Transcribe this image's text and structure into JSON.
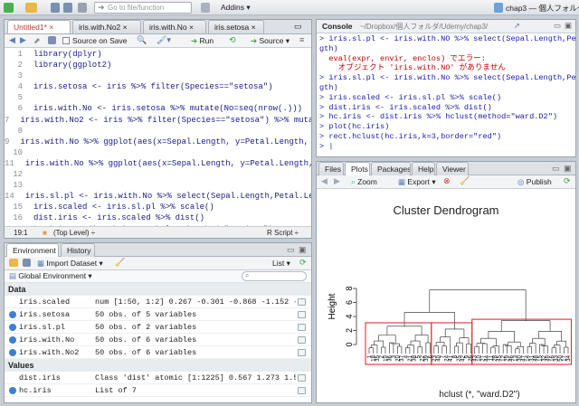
{
  "toolbar": {
    "goto_placeholder": "Go to file/function",
    "addins": "Addins",
    "project": "chap3 — 個人フォルダ"
  },
  "editor": {
    "tabs": [
      "Untitled1*",
      "iris.with.No2",
      "iris.with.No",
      "iris.setosa"
    ],
    "source_on_save": "Source on Save",
    "run": "Run",
    "source": "Source",
    "lines": [
      "library(dplyr)",
      "library(ggplot2)",
      "",
      "iris.setosa <- iris %>% filter(Species==\"setosa\")",
      "",
      "iris.with.No <- iris.setosa %>% mutate(No=seq(nrow(.)))",
      "iris.with.No2 <- iris %>% filter(Species==\"setosa\") %>% mutate(No=seq(nr",
      "",
      "iris.with.No %>% ggplot(aes(x=Sepal.Length, y=Petal.Length, color=Species",
      "",
      "iris.with.No %>% ggplot(aes(x=Sepal.Length, y=Petal.Length, color=Species",
      "",
      "",
      "iris.sl.pl <- iris.with.No %>% select(Sepal.Length,Petal.Length)",
      "iris.scaled <- iris.sl.pl %>% scale()",
      "dist.iris <- iris.scaled %>% dist()",
      "hc.iris <- dist.iris %>% hclust(method=\"ward.D2\")",
      "plot(hc.iris)",
      "rect.hclust(hc.iris,k=3,border=\"red\")",
      ""
    ],
    "status_pos": "19:1",
    "status_level": "(Top Level) ÷",
    "status_type": "R Script ÷"
  },
  "console": {
    "title": "Console",
    "path": "~/Dropbox/個人フォルダ/Udemy/chap3/",
    "lines": [
      {
        "t": "> iris.sl.pl <- iris.with.NO %>% select(Sepal.Length,Petal.Length)",
        "c": "#1a1ab0"
      },
      {
        "t": "gth)",
        "c": "#1a1ab0"
      },
      {
        "t": "  eval(expr, envir, enclos) でエラー:",
        "c": "#c00000"
      },
      {
        "t": "    オブジェクト 'iris.with.NO' がありません",
        "c": "#c00000"
      },
      {
        "t": "> iris.sl.pl <- iris.with.No %>% select(Sepal.Length,Petal.Length)",
        "c": "#1a1ab0"
      },
      {
        "t": "gth)",
        "c": "#1a1ab0"
      },
      {
        "t": "> iris.scaled <- iris.sl.pl %>% scale()",
        "c": "#1a1ab0"
      },
      {
        "t": "> dist.iris <- iris.scaled %>% dist()",
        "c": "#1a1ab0"
      },
      {
        "t": "> hc.iris <- dist.iris %>% hclust(method=\"ward.D2\")",
        "c": "#1a1ab0"
      },
      {
        "t": "> plot(hc.iris)",
        "c": "#1a1ab0"
      },
      {
        "t": "> rect.hclust(hc.iris,k=3,border=\"red\")",
        "c": "#1a1ab0"
      },
      {
        "t": "> |",
        "c": "#1a1ab0"
      }
    ]
  },
  "env": {
    "tabs": [
      "Environment",
      "History"
    ],
    "import": "Import Dataset",
    "list": "List",
    "global": "Global Environment",
    "data_header": "Data",
    "values_header": "Values",
    "data": [
      {
        "name": "iris.scaled",
        "desc": "num [1:50, 1:2] 0.267 -0.301 -0.868 -1.152 -0.0",
        "expand": false
      },
      {
        "name": "iris.setosa",
        "desc": "50 obs. of 5 variables",
        "expand": true
      },
      {
        "name": "iris.sl.pl",
        "desc": "50 obs. of 2 variables",
        "expand": true
      },
      {
        "name": "iris.with.No",
        "desc": "50 obs. of 6 variables",
        "expand": true
      },
      {
        "name": "iris.with.No2",
        "desc": "50 obs. of 6 variables",
        "expand": true
      }
    ],
    "values": [
      {
        "name": "dist.iris",
        "desc": "Class 'dist'  atomic [1:1225] 0.567 1.273 1.531 0.",
        "expand": false
      },
      {
        "name": "hc.iris",
        "desc": "List of 7",
        "expand": true
      }
    ]
  },
  "plots": {
    "tabs": [
      "Files",
      "Plots",
      "Packages",
      "Help",
      "Viewer"
    ],
    "zoom": "Zoom",
    "export": "Export",
    "publish": "Publish",
    "title": "Cluster Dendrogram",
    "ylabel": "Height",
    "yticks": [
      "0",
      "2",
      "4",
      "6",
      "8"
    ],
    "xlabel": "hclust (*, \"ward.D2\")"
  },
  "colors": {
    "accent": "#2a6ebb",
    "rect": "#e03030",
    "error": "#c00000",
    "prompt": "#1a1ab0"
  }
}
